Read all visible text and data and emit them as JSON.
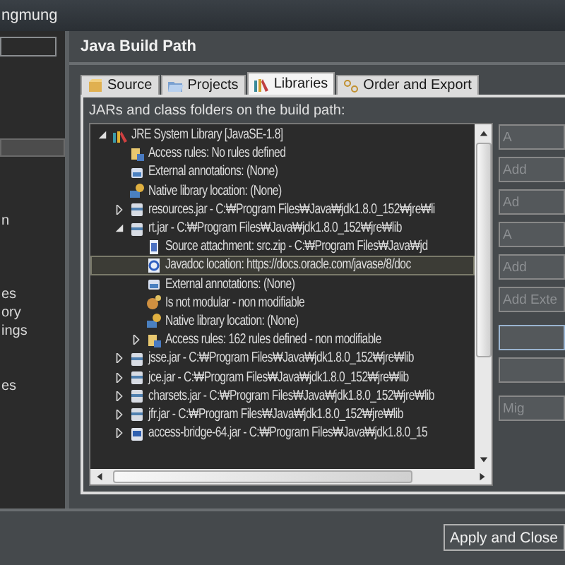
{
  "window": {
    "title": "ngmung"
  },
  "sidebar": {
    "rows": [
      {
        "selected": true
      },
      {
        "label": "n",
        "selected": false
      },
      {
        "label": "es",
        "selected": false
      },
      {
        "label": "ory",
        "selected": false
      },
      {
        "label": "ings",
        "selected": false
      },
      {
        "label": "es",
        "selected": false
      }
    ]
  },
  "page": {
    "title": "Java Build Path"
  },
  "tabs": [
    {
      "label": "Source",
      "kind": "source",
      "selected": false
    },
    {
      "label": "Projects",
      "kind": "projects",
      "selected": false
    },
    {
      "label": "Libraries",
      "kind": "libraries",
      "selected": true
    },
    {
      "label": "Order and Export",
      "kind": "order",
      "selected": false
    }
  ],
  "tree_label": "JARs and class folders on the build path:",
  "tree": [
    {
      "label": "JRE System Library [JavaSE-1.8]",
      "kind": "library",
      "expanded": true,
      "selected": false,
      "children": [
        {
          "label": "Access rules: No rules defined",
          "kind": "access",
          "selected": false
        },
        {
          "label": "External annotations: (None)",
          "kind": "annotations",
          "selected": false
        },
        {
          "label": "Native library location: (None)",
          "kind": "native",
          "selected": false
        },
        {
          "label": "resources.jar - C:₩Program Files₩Java₩jdk1.8.0_152₩jre₩li",
          "kind": "jar",
          "expanded": false,
          "selected": false
        },
        {
          "label": "rt.jar - C:₩Program Files₩Java₩jdk1.8.0_152₩jre₩lib",
          "kind": "jar",
          "expanded": true,
          "selected": false,
          "children": [
            {
              "label": "Source attachment: src.zip - C:₩Program Files₩Java₩jd",
              "kind": "source",
              "selected": false
            },
            {
              "label": "Javadoc location: https://docs.oracle.com/javase/8/doc",
              "kind": "javadoc",
              "selected": true
            },
            {
              "label": "External annotations: (None)",
              "kind": "annotations",
              "selected": false
            },
            {
              "label": "Is not modular - non modifiable",
              "kind": "module",
              "selected": false
            },
            {
              "label": "Native library location: (None)",
              "kind": "native",
              "selected": false
            },
            {
              "label": "Access rules: 162 rules defined - non modifiable",
              "kind": "access",
              "expanded": false,
              "selected": false
            }
          ]
        },
        {
          "label": "jsse.jar - C:₩Program Files₩Java₩jdk1.8.0_152₩jre₩lib",
          "kind": "jar",
          "expanded": false,
          "selected": false
        },
        {
          "label": "jce.jar - C:₩Program Files₩Java₩jdk1.8.0_152₩jre₩lib",
          "kind": "jar",
          "expanded": false,
          "selected": false
        },
        {
          "label": "charsets.jar - C:₩Program Files₩Java₩jdk1.8.0_152₩jre₩lib",
          "kind": "jar",
          "expanded": false,
          "selected": false
        },
        {
          "label": "jfr.jar - C:₩Program Files₩Java₩jdk1.8.0_152₩jre₩lib",
          "kind": "jar",
          "expanded": false,
          "selected": false
        },
        {
          "label": "access-bridge-64.jar - C:₩Program Files₩Java₩jdk1.8.0_15",
          "kind": "bridge",
          "expanded": false,
          "selected": false
        }
      ]
    }
  ],
  "side_buttons": [
    {
      "label": "A",
      "default": false
    },
    {
      "label": "Add",
      "default": false
    },
    {
      "label": "Ad",
      "default": false
    },
    {
      "label": "A",
      "default": false
    },
    {
      "label": "Add",
      "default": false
    },
    {
      "label": "Add Exte",
      "default": false
    },
    {
      "default": true
    },
    {
      "default": false
    },
    {
      "label": "Mig",
      "default": false
    }
  ],
  "footer": {
    "button": "Apply and Close"
  }
}
